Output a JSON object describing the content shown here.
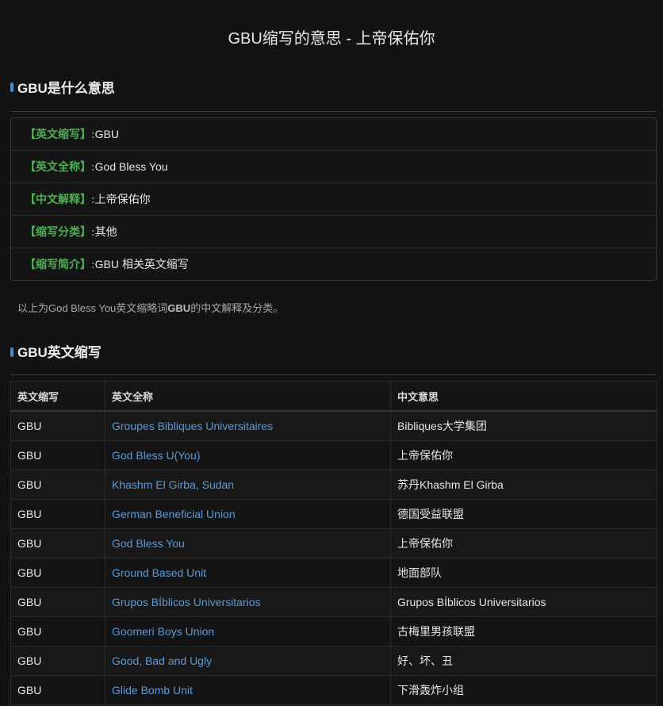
{
  "page_title": "GBU缩写的意思 - 上帝保佑你",
  "section1": {
    "heading": "GBU是什么意思",
    "rows": [
      {
        "label": "【英文缩写】",
        "sep": ":",
        "value": "GBU"
      },
      {
        "label": "【英文全称】",
        "sep": ":",
        "value": "God Bless You"
      },
      {
        "label": "【中文解释】",
        "sep": ":",
        "value": "上帝保佑你"
      },
      {
        "label": "【缩写分类】",
        "sep": ":",
        "value": "其他"
      },
      {
        "label": "【缩写简介】",
        "sep": ":",
        "value": "GBU 相关英文缩写"
      }
    ],
    "summary": {
      "pre": "以上为God Bless You英文缩略词",
      "term": "GBU",
      "post": "的中文解释及分类。"
    }
  },
  "section2": {
    "heading": "GBU英文缩写",
    "table": {
      "headers": [
        "英文缩写",
        "英文全称",
        "中文意思"
      ],
      "rows": [
        [
          "GBU",
          "Groupes Bibliques Universitaires",
          "Bibliques大学集团"
        ],
        [
          "GBU",
          "God Bless U(You)",
          "上帝保佑你"
        ],
        [
          "GBU",
          "Khashm El Girba, Sudan",
          "苏丹Khashm El Girba"
        ],
        [
          "GBU",
          "German Beneficial Union",
          "德国受益联盟"
        ],
        [
          "GBU",
          "God Bless You",
          "上帝保佑你"
        ],
        [
          "GBU",
          "Ground Based Unit",
          "地面部队"
        ],
        [
          "GBU",
          "Grupos BÍblicos Universitarios",
          "Grupos BÍblicos Universitarios"
        ],
        [
          "GBU",
          "Goomeri Boys Union",
          "古梅里男孩联盟"
        ],
        [
          "GBU",
          "Good, Bad and Ugly",
          "好、坏、丑"
        ],
        [
          "GBU",
          "Glide Bomb Unit",
          "下滑轰炸小组"
        ]
      ]
    }
  },
  "colors": {
    "background": "#131313",
    "label_green": "#4caf50",
    "link_blue": "#5b9bd5",
    "heading_bar": "#3a8fd6"
  }
}
